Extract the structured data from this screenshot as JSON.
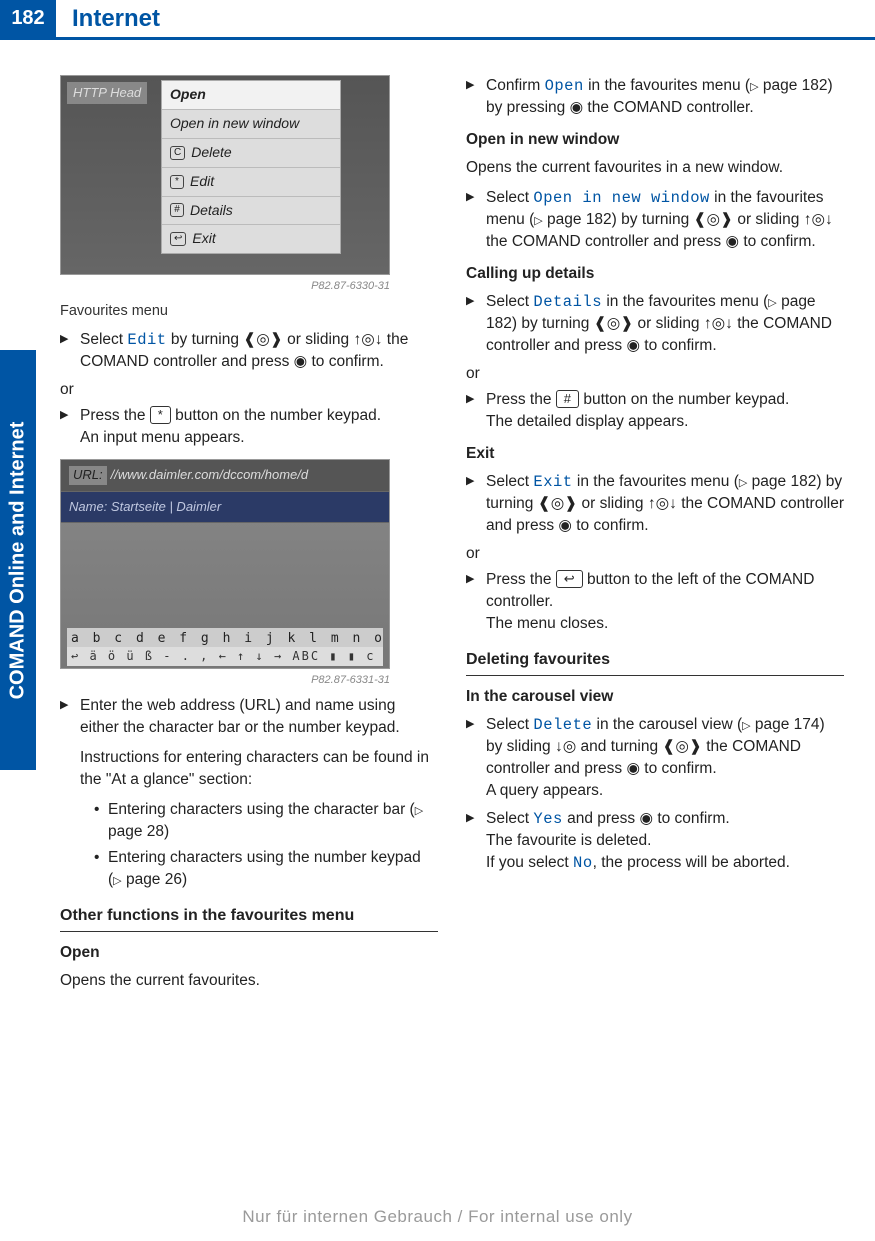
{
  "page_number": "182",
  "header_title": "Internet",
  "side_tab": "COMAND Online and Internet",
  "footer": "Nur für internen Gebrauch / For internal use only",
  "img1": {
    "http_head": "HTTP Head",
    "rows": [
      "Open",
      "Open in new window",
      "Delete",
      "Edit",
      "Details",
      "Exit"
    ],
    "row_keys": [
      "",
      "",
      "C",
      "*",
      "#",
      "↩"
    ],
    "code": "P82.87-6330-31",
    "caption": "Favourites menu"
  },
  "img2": {
    "url_label": "URL:",
    "url_value": "//www.daimler.com/dccom/home/d",
    "name_label": "Name:",
    "name_value": "Startseite | Daimler",
    "charbar1": "a b c d e f g h i j k l m n o p q r s t u v w x y z _ ok",
    "charbar2": "↩   ä ö ü ß - . , ← ↑ ↓ → ABC ▮ ▮ c",
    "code": "P82.87-6331-31"
  },
  "left": {
    "step1_a": "Select ",
    "step1_ui": "Edit",
    "step1_b": " by turning ",
    "step1_c": " or sliding ",
    "step1_d": " the COMAND controller and press ",
    "step1_e": " to confirm.",
    "or": "or",
    "step2_a": "Press the ",
    "step2_key": "*",
    "step2_b": " button on the number keypad.",
    "step2_result": "An input menu appears.",
    "step3_a": "Enter the web address (URL) and name using either the character bar or the number keypad.",
    "step3_note": "Instructions for entering characters can be found in the \"At a glance\" section:",
    "bullet1_a": "Entering characters using the character bar (",
    "bullet1_page": " page 28)",
    "bullet2_a": "Entering characters using the number keypad (",
    "bullet2_page": " page 26)",
    "h2": "Other functions in the favourites menu",
    "h3_open": "Open",
    "open_body": "Opens the current favourites."
  },
  "right": {
    "r1_a": "Confirm ",
    "r1_ui": "Open",
    "r1_b": " in the favourites menu (",
    "r1_page": " page 182) by pressing ",
    "r1_c": " the COMAND controller.",
    "h3_new": "Open in new window",
    "p_new": "Opens the current favourites in a new window.",
    "r2_a": "Select ",
    "r2_ui": "Open in new window",
    "r2_b": " in the favourites menu (",
    "r2_page": " page 182) by turning ",
    "r2_c": " or sliding ",
    "r2_d": " the COMAND controller and press ",
    "r2_e": " to confirm.",
    "h3_details": "Calling up details",
    "r3_a": "Select ",
    "r3_ui": "Details",
    "r3_b": " in the favourites menu (",
    "r3_page": " page 182) by turning ",
    "r3_c": " or sliding ",
    "r3_d": " the COMAND controller and press ",
    "r3_e": " to confirm.",
    "or": "or",
    "r4_a": "Press the ",
    "r4_key": "#",
    "r4_b": " button on the number keypad.",
    "r4_result": "The detailed display appears.",
    "h3_exit": "Exit",
    "r5_a": "Select ",
    "r5_ui": "Exit",
    "r5_b": " in the favourites menu (",
    "r5_page": " page 182) by turning ",
    "r5_c": " or sliding ",
    "r5_d": " the COMAND controller and press ",
    "r5_e": " to confirm.",
    "r6_a": "Press the ",
    "r6_key": "↩",
    "r6_b": " button to the left of the COMAND controller.",
    "r6_result": "The menu closes.",
    "h2_del": "Deleting favourites",
    "h3_car": "In the carousel view",
    "r7_a": "Select ",
    "r7_ui": "Delete",
    "r7_b": " in the carousel view (",
    "r7_page": " page 174) by sliding ",
    "r7_c": " and turning ",
    "r7_d": " the COMAND controller and press ",
    "r7_e": " to confirm.",
    "r7_result": "A query appears.",
    "r8_a": "Select ",
    "r8_ui": "Yes",
    "r8_b": " and press ",
    "r8_c": " to confirm.",
    "r8_result": "The favourite is deleted.",
    "r8_alt_a": "If you select ",
    "r8_alt_ui": "No",
    "r8_alt_b": ", the process will be aborted."
  },
  "symbols": {
    "turn": "❰◎❱",
    "slide_v": "↑◎↓",
    "slide_d": "↓◎",
    "press": "◉",
    "xref": "▷"
  }
}
